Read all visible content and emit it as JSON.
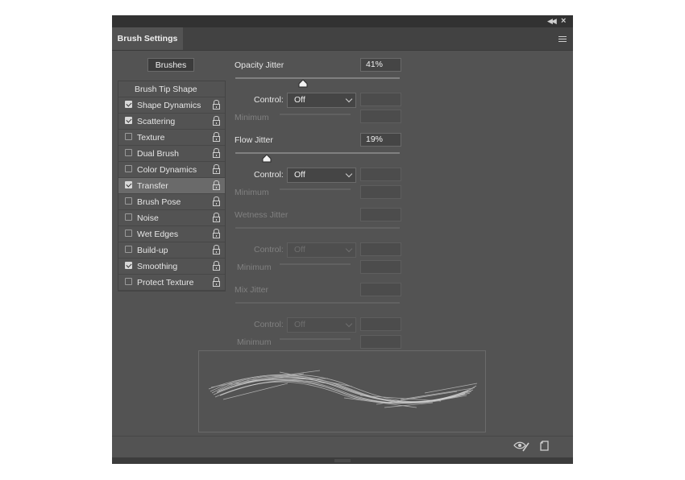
{
  "panel": {
    "tab_title": "Brush Settings",
    "brushes_button": "Brushes"
  },
  "sidebar": {
    "header": "Brush Tip Shape",
    "items": [
      {
        "label": "Shape Dynamics",
        "checked": true
      },
      {
        "label": "Scattering",
        "checked": true
      },
      {
        "label": "Texture",
        "checked": false
      },
      {
        "label": "Dual Brush",
        "checked": false
      },
      {
        "label": "Color Dynamics",
        "checked": false
      },
      {
        "label": "Transfer",
        "checked": true,
        "selected": true
      },
      {
        "label": "Brush Pose",
        "checked": false
      },
      {
        "label": "Noise",
        "checked": false
      },
      {
        "label": "Wet Edges",
        "checked": false
      },
      {
        "label": "Build-up",
        "checked": false
      },
      {
        "label": "Smoothing",
        "checked": true
      },
      {
        "label": "Protect Texture",
        "checked": false
      }
    ]
  },
  "settings": {
    "opacity_jitter": {
      "label": "Opacity Jitter",
      "value": "41%",
      "fraction": 0.41,
      "control_label": "Control:",
      "control_value": "Off",
      "minimum_label": "Minimum",
      "enabled": true
    },
    "flow_jitter": {
      "label": "Flow Jitter",
      "value": "19%",
      "fraction": 0.19,
      "control_label": "Control:",
      "control_value": "Off",
      "minimum_label": "Minimum",
      "enabled": true
    },
    "wetness_jitter": {
      "label": "Wetness Jitter",
      "value": "",
      "control_label": "Control:",
      "control_value": "Off",
      "minimum_label": "Minimum",
      "enabled": false
    },
    "mix_jitter": {
      "label": "Mix Jitter",
      "value": "",
      "control_label": "Control:",
      "control_value": "Off",
      "minimum_label": "Minimum",
      "enabled": false
    }
  },
  "icons": {
    "collapse": "double-chevron-left-icon",
    "close": "close-icon",
    "menu": "hamburger-menu-icon",
    "lock": "lock-icon",
    "toggle_live_tip": "eye-brush-icon",
    "new_preset": "new-preset-icon"
  },
  "colors": {
    "panel_bg": "#535353",
    "title_bar": "#323232",
    "selected_row": "#6a6a6a"
  }
}
